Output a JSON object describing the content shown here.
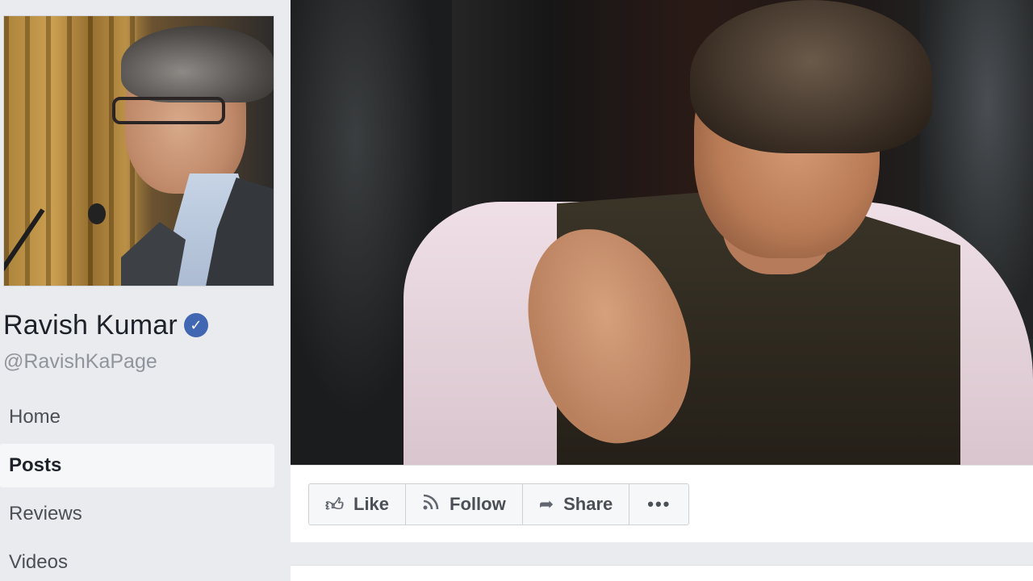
{
  "page": {
    "name": "Ravish Kumar",
    "handle": "@RavishKaPage",
    "verified_icon": "verified-check-icon"
  },
  "nav": {
    "items": [
      {
        "label": "Home",
        "active": false
      },
      {
        "label": "Posts",
        "active": true
      },
      {
        "label": "Reviews",
        "active": false
      },
      {
        "label": "Videos",
        "active": false
      }
    ]
  },
  "actions": {
    "like_label": "Like",
    "follow_label": "Follow",
    "share_label": "Share",
    "more_label": "•••"
  },
  "icons": {
    "like": "thumbs-up-icon",
    "follow": "rss-icon",
    "share": "share-arrow-icon"
  },
  "colors": {
    "background": "#e9ebee",
    "verified": "#4267b2",
    "text_primary": "#1d2129",
    "text_secondary": "#90949c"
  }
}
